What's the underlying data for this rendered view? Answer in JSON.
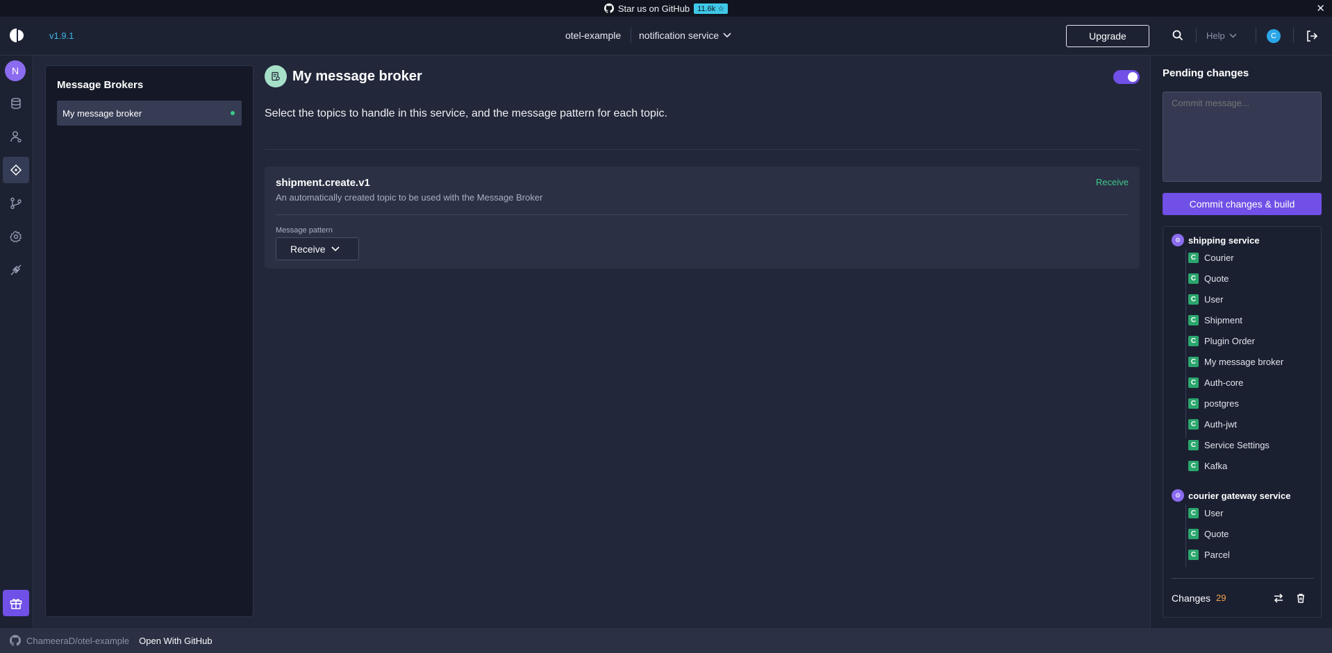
{
  "banner": {
    "text": "Star us on GitHub",
    "stars": "11.6k ☆"
  },
  "header": {
    "version": "v1.9.1",
    "project": "otel-example",
    "service": "notification service",
    "upgrade_label": "Upgrade",
    "help_label": "Help",
    "user_initial": "C"
  },
  "sidebar": {
    "workspace_initial": "N"
  },
  "brokers": {
    "title": "Message Brokers",
    "items": [
      {
        "label": "My message broker"
      }
    ]
  },
  "main": {
    "title": "My message broker",
    "description": "Select the topics to handle in this service, and the message pattern for each topic.",
    "topic": {
      "name": "shipment.create.v1",
      "description": "An automatically created topic to be used with the Message Broker",
      "tag": "Receive",
      "pattern_label": "Message pattern",
      "pattern_value": "Receive"
    }
  },
  "pending": {
    "title": "Pending changes",
    "commit_placeholder": "Commit message...",
    "commit_button": "Commit changes & build",
    "services": [
      {
        "name": "shipping service",
        "changes": [
          "Courier",
          "Quote",
          "User",
          "Shipment",
          "Plugin Order",
          "My message broker",
          "Auth-core",
          "postgres",
          "Auth-jwt",
          "Service Settings",
          "Kafka"
        ]
      },
      {
        "name": "courier gateway service",
        "changes": [
          "User",
          "Quote",
          "Parcel"
        ]
      }
    ],
    "change_badge": "C",
    "changes_label": "Changes",
    "changes_count": "29"
  },
  "footer": {
    "repo": "ChameeraD/otel-example",
    "open_label": "Open With GitHub"
  },
  "colors": {
    "accent": "#7050e6",
    "success": "#3ec98a",
    "link": "#3fb8e6",
    "count": "#f5a347"
  }
}
